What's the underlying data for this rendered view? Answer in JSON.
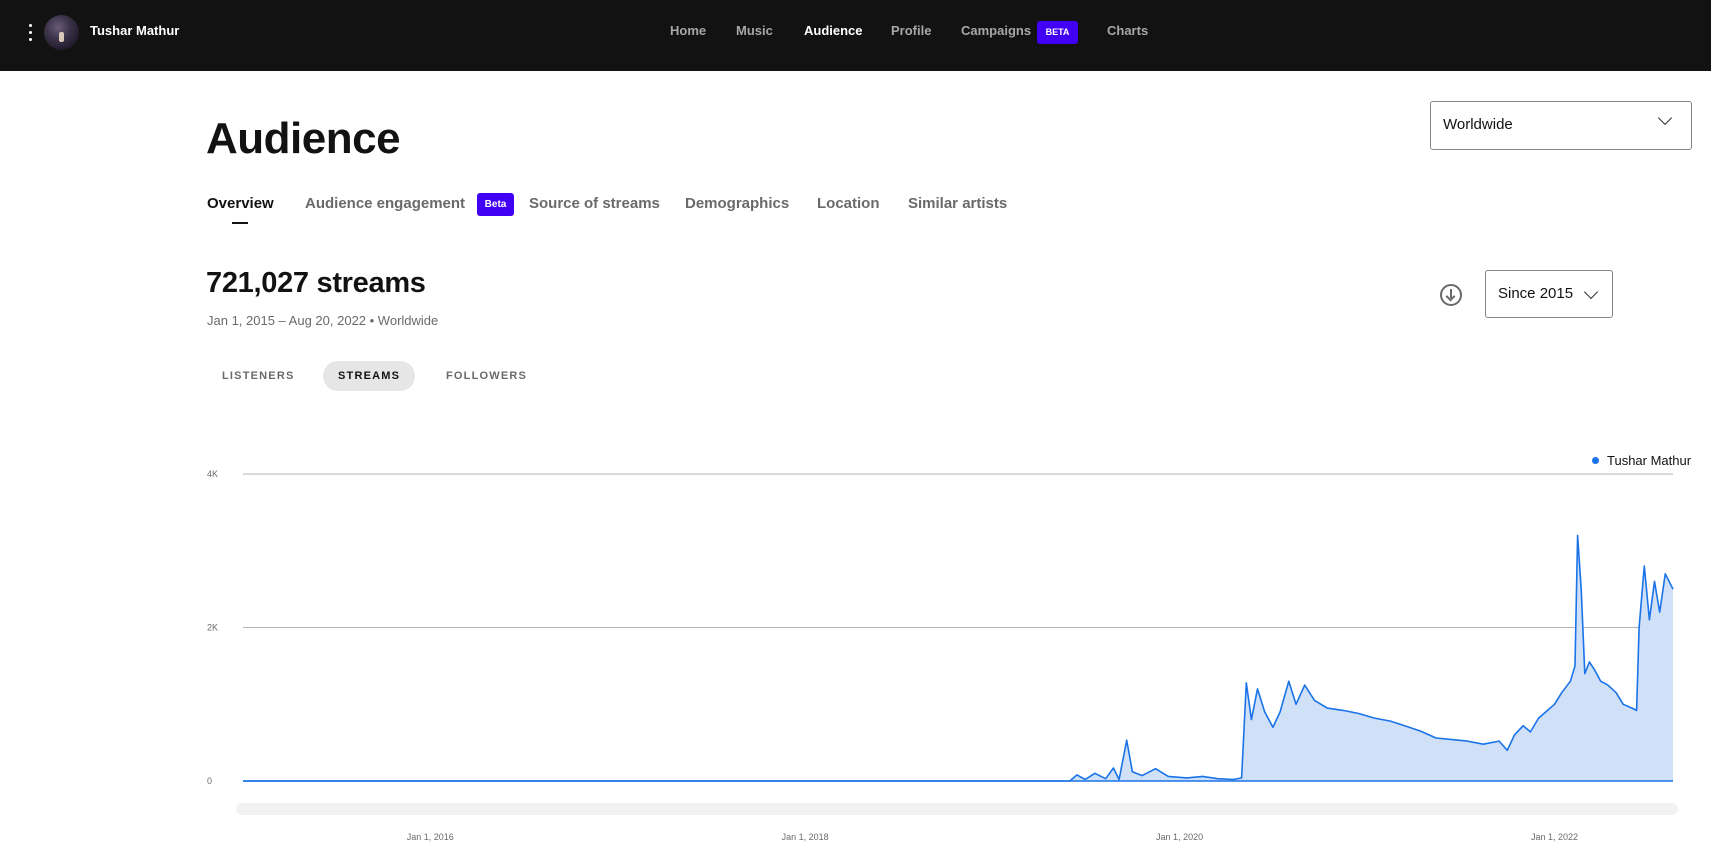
{
  "topbar": {
    "artist_name": "Tushar Mathur",
    "nav": [
      "Home",
      "Music",
      "Audience",
      "Profile",
      "Campaigns",
      "Charts"
    ],
    "active_nav": "Audience",
    "campaigns_badge": "BETA"
  },
  "page": {
    "title": "Audience",
    "region": "Worldwide"
  },
  "tabs": {
    "items": [
      "Overview",
      "Audience engagement",
      "Source of streams",
      "Demographics",
      "Location",
      "Similar artists"
    ],
    "active": "Overview",
    "engagement_badge": "Beta"
  },
  "stats": {
    "headline": "721,027 streams",
    "subline": "Jan 1, 2015 – Aug 20, 2022 • Worldwide",
    "period": "Since 2015"
  },
  "metrics": {
    "items": [
      "LISTENERS",
      "STREAMS",
      "FOLLOWERS"
    ],
    "active": "STREAMS"
  },
  "chart_data": {
    "type": "area",
    "series": [
      {
        "name": "Tushar Mathur",
        "color": "#1a73e8",
        "fill": "#cfe0f7",
        "points": [
          [
            "2015-01-01",
            0
          ],
          [
            "2019-06-01",
            0
          ],
          [
            "2019-06-15",
            80
          ],
          [
            "2019-07-01",
            20
          ],
          [
            "2019-07-20",
            100
          ],
          [
            "2019-08-10",
            30
          ],
          [
            "2019-08-25",
            170
          ],
          [
            "2019-09-05",
            20
          ],
          [
            "2019-09-20",
            530
          ],
          [
            "2019-10-01",
            120
          ],
          [
            "2019-10-20",
            70
          ],
          [
            "2019-11-15",
            160
          ],
          [
            "2019-12-10",
            60
          ],
          [
            "2020-01-15",
            40
          ],
          [
            "2020-02-15",
            60
          ],
          [
            "2020-03-15",
            30
          ],
          [
            "2020-04-15",
            20
          ],
          [
            "2020-05-01",
            40
          ],
          [
            "2020-05-10",
            1280
          ],
          [
            "2020-05-20",
            800
          ],
          [
            "2020-06-01",
            1200
          ],
          [
            "2020-06-15",
            900
          ],
          [
            "2020-07-01",
            700
          ],
          [
            "2020-07-15",
            900
          ],
          [
            "2020-08-01",
            1300
          ],
          [
            "2020-08-15",
            1000
          ],
          [
            "2020-09-01",
            1250
          ],
          [
            "2020-09-20",
            1050
          ],
          [
            "2020-10-15",
            950
          ],
          [
            "2020-11-15",
            920
          ],
          [
            "2020-12-15",
            880
          ],
          [
            "2021-01-15",
            820
          ],
          [
            "2021-02-15",
            780
          ],
          [
            "2021-03-15",
            720
          ],
          [
            "2021-04-15",
            650
          ],
          [
            "2021-05-15",
            560
          ],
          [
            "2021-06-15",
            540
          ],
          [
            "2021-07-15",
            520
          ],
          [
            "2021-08-15",
            480
          ],
          [
            "2021-09-15",
            520
          ],
          [
            "2021-10-01",
            400
          ],
          [
            "2021-10-15",
            600
          ],
          [
            "2021-11-01",
            720
          ],
          [
            "2021-11-15",
            640
          ],
          [
            "2021-12-01",
            820
          ],
          [
            "2021-12-15",
            900
          ],
          [
            "2022-01-01",
            1000
          ],
          [
            "2022-01-15",
            1150
          ],
          [
            "2022-02-01",
            1300
          ],
          [
            "2022-02-10",
            1500
          ],
          [
            "2022-02-15",
            3200
          ],
          [
            "2022-02-22",
            2500
          ],
          [
            "2022-03-01",
            1400
          ],
          [
            "2022-03-10",
            1550
          ],
          [
            "2022-03-20",
            1450
          ],
          [
            "2022-04-01",
            1300
          ],
          [
            "2022-04-15",
            1250
          ],
          [
            "2022-05-01",
            1150
          ],
          [
            "2022-05-15",
            1000
          ],
          [
            "2022-06-01",
            950
          ],
          [
            "2022-06-10",
            920
          ],
          [
            "2022-06-15",
            2000
          ],
          [
            "2022-06-25",
            2800
          ],
          [
            "2022-07-05",
            2100
          ],
          [
            "2022-07-15",
            2600
          ],
          [
            "2022-07-25",
            2200
          ],
          [
            "2022-08-05",
            2700
          ],
          [
            "2022-08-20",
            2500
          ]
        ]
      }
    ],
    "x_ticks": [
      "Jan 1, 2016",
      "Jan 1, 2018",
      "Jan 1, 2020",
      "Jan 1, 2022"
    ],
    "y_ticks": [
      "0",
      "2K",
      "4K"
    ],
    "ylim": [
      0,
      4000
    ],
    "xlim": [
      "2015-01-01",
      "2022-08-20"
    ],
    "grid": true,
    "legend_position": "top-right"
  }
}
